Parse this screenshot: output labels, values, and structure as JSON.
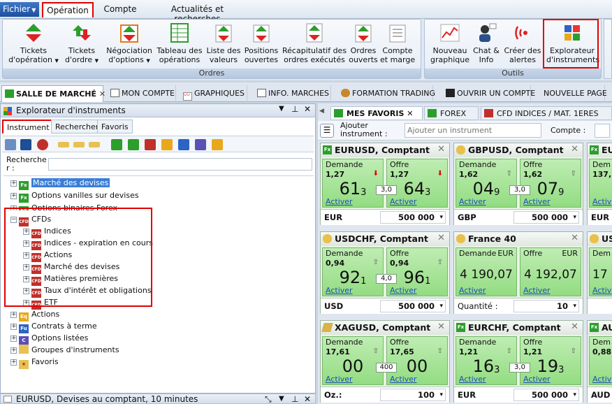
{
  "menubar": {
    "file": "Fichier",
    "tabs": [
      "Opération",
      "Compte",
      "Actualités et recherches"
    ]
  },
  "ribbon": {
    "orders_group": "Ordres",
    "tools_group": "Outils",
    "buttons": [
      {
        "l1": "Tickets",
        "l2": "d'opération"
      },
      {
        "l1": "Tickets",
        "l2": "d'ordre"
      },
      {
        "l1": "Négociation",
        "l2": "d'options"
      },
      {
        "l1": "Tableau des",
        "l2": "opérations"
      },
      {
        "l1": "Liste des",
        "l2": "valeurs"
      },
      {
        "l1": "Positions",
        "l2": "ouvertes"
      },
      {
        "l1": "Récapitulatif des",
        "l2": "ordres exécutés"
      },
      {
        "l1": "Ordres",
        "l2": "ouverts"
      },
      {
        "l1": "Compte",
        "l2": "et marge"
      },
      {
        "l1": "Nouveau",
        "l2": "graphique"
      },
      {
        "l1": "Chat &",
        "l2": "Info"
      },
      {
        "l1": "Créer des",
        "l2": "alertes"
      },
      {
        "l1": "Explorateur",
        "l2": "d'instruments"
      }
    ]
  },
  "workspace_tabs": [
    "SALLE DE MARCHÉ",
    "MON COMPTE",
    "GRAPHIQUES",
    "INFO. MARCHES",
    "FORMATION TRADING",
    "OUVRIR UN COMPTE",
    "NOUVELLE PAGE"
  ],
  "explorer": {
    "title": "Explorateur d'instruments",
    "subtabs": [
      "Instrument",
      "Rechercher",
      "Favoris"
    ],
    "search_label": "Recherche r :",
    "tree": [
      "Marché des devises",
      "Options vanilles sur devises",
      "Options binaires Forex",
      "CFDs",
      "Indices",
      "Indices - expiration en cours",
      "Actions",
      "Marché des devises",
      "Matières premières",
      "Taux d'intérêt et obligations",
      "ETF",
      "Actions",
      "Contrats à terme",
      "Options listées",
      "Groupes d'instruments",
      "Favoris"
    ]
  },
  "bottom_panel_title": "EURUSD, Devises au comptant, 10 minutes",
  "trade_tabs": [
    "MES FAVORIS",
    "FOREX",
    "CFD INDICES / MAT. 1ERES"
  ],
  "trade_toolbar": {
    "add_label": "Ajouter instrument :",
    "add_placeholder": "Ajouter un instrument",
    "account_label": "Compte :"
  },
  "tiles": [
    {
      "title": "EURUSD, Comptant",
      "bid_label": "Demande",
      "ask_label": "Offre",
      "bid_small": "1,27",
      "bid_big": "61",
      "bid_sub": "3",
      "ask_small": "1,27",
      "ask_big": "64",
      "ask_sub": "3",
      "spread": "3,0",
      "action": "Activer",
      "ccy": "EUR",
      "amount": "500 000"
    },
    {
      "title": "GBPUSD, Comptant",
      "bid_label": "Demande",
      "ask_label": "Offre",
      "bid_small": "1,62",
      "bid_big": "04",
      "bid_sub": "9",
      "ask_small": "1,62",
      "ask_big": "07",
      "ask_sub": "9",
      "spread": "3,0",
      "action": "Activer",
      "ccy": "GBP",
      "amount": "500 000"
    },
    {
      "title": "USDCHF, Comptant",
      "bid_label": "Demande",
      "ask_label": "Offre",
      "bid_small": "0,94",
      "bid_big": "92",
      "bid_sub": "1",
      "ask_small": "0,94",
      "ask_big": "96",
      "ask_sub": "1",
      "spread": "4,0",
      "action": "Activer",
      "ccy": "USD",
      "amount": "500 000"
    },
    {
      "title": "France 40",
      "bid_label": "Demande",
      "ask_label": "Offre",
      "bid_ccy": "EUR",
      "ask_ccy": "EUR",
      "bid_big": "4 190,07",
      "ask_big": "4 192,07",
      "action": "Activer",
      "ccy": "Quantité :",
      "amount": "10"
    },
    {
      "title": "XAGUSD, Comptant",
      "bid_label": "Demande",
      "ask_label": "Offre",
      "bid_small": "17,61",
      "bid_big": "00",
      "ask_small": "17,65",
      "ask_big": "00",
      "spread": "400",
      "action": "Activer",
      "ccy": "Oz.:",
      "amount": "100"
    },
    {
      "title": "EURCHF, Comptant",
      "bid_label": "Demande",
      "ask_label": "Offre",
      "bid_small": "1,21",
      "bid_big": "16",
      "bid_sub": "3",
      "ask_small": "1,21",
      "ask_big": "19",
      "ask_sub": "3",
      "spread": "3,0",
      "action": "Activer",
      "ccy": "EUR",
      "amount": "500 000"
    }
  ],
  "partial_tiles": [
    {
      "title": "EU",
      "bid_label": "Dem",
      "bid_small": "137,",
      "action": "Activ",
      "ccy": "EUR"
    },
    {
      "title": "US",
      "bid_label": "Dem",
      "bid_big": "17",
      "action": "Activ",
      "ccy": ""
    },
    {
      "title": "AU",
      "bid_label": "Dem",
      "bid_small": "0,88",
      "action": "Activ",
      "ccy": "AUD"
    }
  ]
}
